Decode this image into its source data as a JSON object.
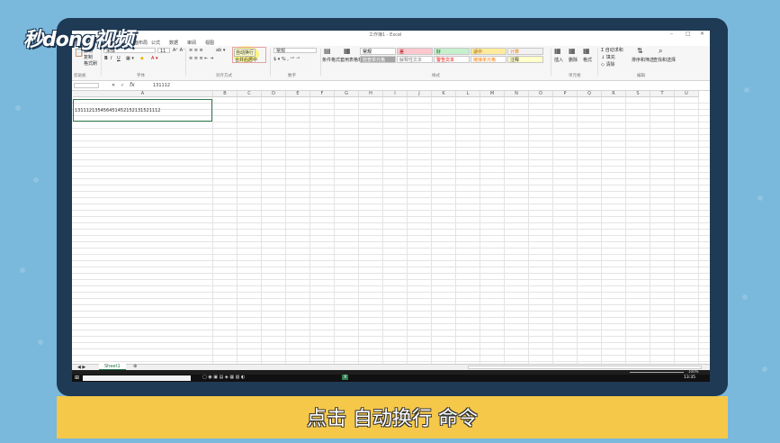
{
  "brand": {
    "logo_text": "秒dong视频"
  },
  "subtitle": "点击 自动换行 命令",
  "window": {
    "title": "工作簿1 - Excel"
  },
  "tabs": [
    "文件",
    "开始",
    "插入",
    "页面布局",
    "公式",
    "数据",
    "审阅",
    "视图"
  ],
  "ribbon": {
    "clipboard": {
      "cut": "剪切",
      "copy": "复制",
      "paste_format": "格式刷",
      "label": "剪贴板"
    },
    "font": {
      "name": "宋体",
      "size": "11",
      "bold": "B",
      "italic": "I",
      "underline": "U",
      "label": "字体"
    },
    "alignment": {
      "wrap_text": "自动换行",
      "merge_center": "合并后居中",
      "label": "对齐方式"
    },
    "number": {
      "format": "常规",
      "label": "数字"
    },
    "styles": {
      "conditional": "条件格式",
      "table_format": "套用表格格式",
      "cells": [
        {
          "text": "常规",
          "bg": "#ffffff",
          "fg": "#000000"
        },
        {
          "text": "差",
          "bg": "#ffc7ce",
          "fg": "#9c0006"
        },
        {
          "text": "好",
          "bg": "#c6efce",
          "fg": "#006100"
        },
        {
          "text": "适中",
          "bg": "#ffeb9c",
          "fg": "#9c5700"
        },
        {
          "text": "计算",
          "bg": "#f2f2f2",
          "fg": "#fa7d00"
        },
        {
          "text": "检查单元格",
          "bg": "#a5a5a5",
          "fg": "#ffffff"
        },
        {
          "text": "解释性文本",
          "bg": "#ffffff",
          "fg": "#7f7f7f"
        },
        {
          "text": "警告文本",
          "bg": "#ffffff",
          "fg": "#ff0000"
        },
        {
          "text": "链接单元格",
          "bg": "#ffffff",
          "fg": "#fa7d00"
        },
        {
          "text": "注释",
          "bg": "#ffffcc",
          "fg": "#333333"
        }
      ],
      "label": "样式"
    },
    "cells_group": {
      "insert": "插入",
      "delete": "删除",
      "format": "格式",
      "label": "单元格"
    },
    "editing": {
      "autosum": "自动求和",
      "fill": "填充",
      "clear": "清除",
      "sort_filter": "排序和筛选",
      "find_select": "查找和选择",
      "label": "编辑"
    }
  },
  "formula_bar": {
    "fx": "fx",
    "value": "131112"
  },
  "columns": [
    "A",
    "B",
    "C",
    "D",
    "E",
    "F",
    "G",
    "H",
    "I",
    "J",
    "K",
    "L",
    "M",
    "N",
    "O",
    "P",
    "Q",
    "R",
    "S",
    "T",
    "U"
  ],
  "cell_a1": "131112135456451452152131521112",
  "sheet_tab": "Sheet1",
  "status": {
    "zoom": "100%"
  },
  "taskbar": {
    "time": "13:35"
  }
}
